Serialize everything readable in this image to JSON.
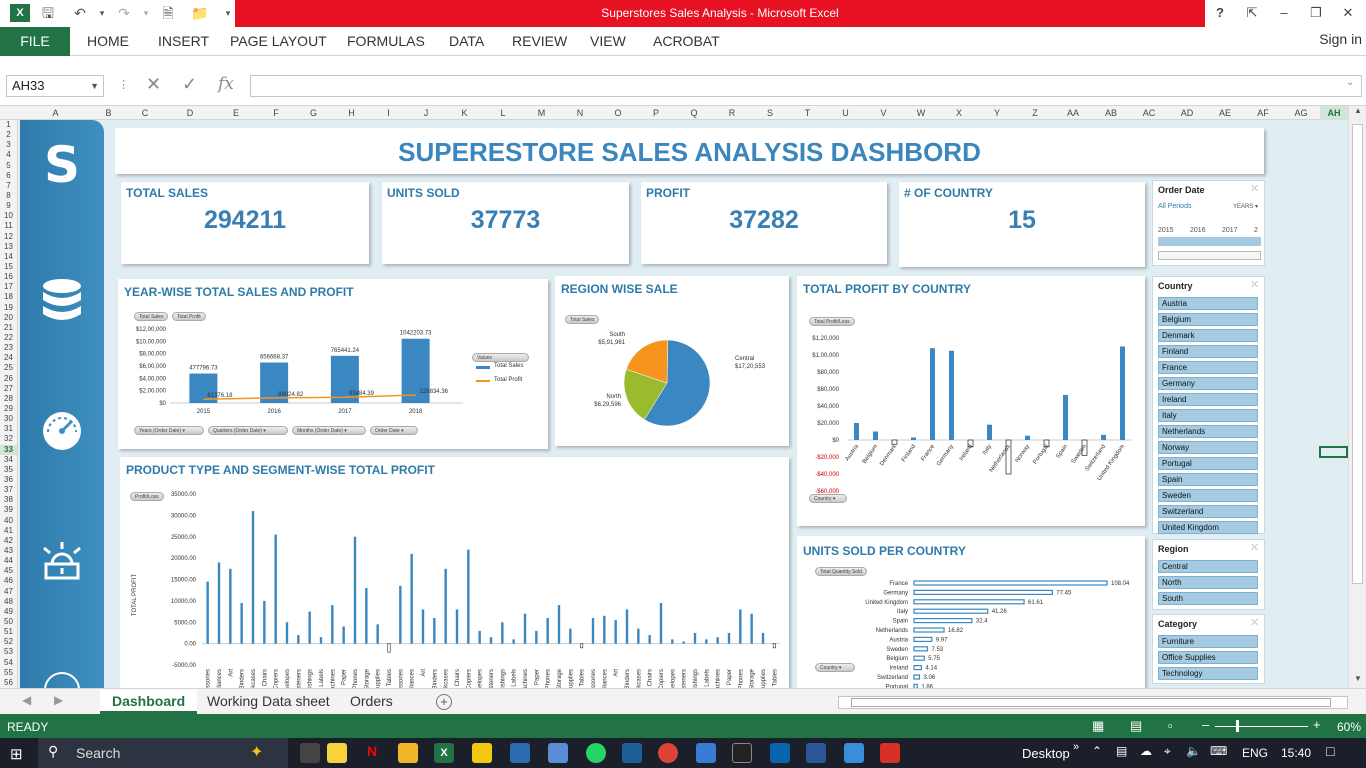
{
  "window": {
    "title": "Superstores Sales Analysis -  Microsoft Excel",
    "help": "?"
  },
  "ribbon": {
    "file": "FILE",
    "tabs": [
      "HOME",
      "INSERT",
      "PAGE LAYOUT",
      "FORMULAS",
      "DATA",
      "REVIEW",
      "VIEW",
      "ACROBAT"
    ],
    "sign_in": "Sign in"
  },
  "formula_bar": {
    "name_box": "AH33",
    "fx": "fx",
    "formula": ""
  },
  "columns": [
    "A",
    "B",
    "C",
    "D",
    "E",
    "F",
    "G",
    "H",
    "I",
    "J",
    "K",
    "L",
    "M",
    "N",
    "O",
    "P",
    "Q",
    "R",
    "S",
    "T",
    "U",
    "V",
    "W",
    "X",
    "Y",
    "Z",
    "AA",
    "AB",
    "AC",
    "AD",
    "AE",
    "AF",
    "AG",
    "AH"
  ],
  "rows": [
    "1",
    "2",
    "3",
    "4",
    "5",
    "6",
    "7",
    "8",
    "9",
    "10",
    "11",
    "12",
    "13",
    "14",
    "15",
    "16",
    "17",
    "18",
    "19",
    "20",
    "21",
    "22",
    "23",
    "24",
    "25",
    "26",
    "27",
    "28",
    "29",
    "30",
    "31",
    "32",
    "33",
    "34",
    "35",
    "36",
    "37",
    "38",
    "39",
    "40",
    "41",
    "42",
    "43",
    "44",
    "45",
    "46",
    "47",
    "48",
    "49",
    "50",
    "51",
    "52",
    "53",
    "54",
    "55",
    "56"
  ],
  "dashboard": {
    "title": "SUPERESTORE SALES ANALYSIS DASHBORD",
    "sidebar_logo": "S",
    "kpis": [
      {
        "label": "TOTAL SALES",
        "value": "294211"
      },
      {
        "label": "UNITS SOLD",
        "value": "37773"
      },
      {
        "label": "PROFIT",
        "value": "37282"
      },
      {
        "label": "# OF COUNTRY",
        "value": "15"
      }
    ],
    "year_chart": {
      "title": "YEAR-WISE TOTAL SALES AND PROFIT",
      "pills": [
        "Total Sales",
        "Total Profit"
      ],
      "legend_title": "Values",
      "filters": [
        "Years (Order Date)",
        "Quarters (Order Date)",
        "Months (Order Date)",
        "Order Date"
      ]
    },
    "region_chart": {
      "title": "REGION WISE SALE",
      "pill": "Total Sales"
    },
    "profit_country_chart": {
      "title": "TOTAL PROFIT BY COUNTRY",
      "pill": "Total Profit/Loss",
      "filter": "Country"
    },
    "units_country_chart": {
      "title": "UNITS SOLD PER COUNTRY",
      "pill": "Total Quantity Sold",
      "filter": "Country"
    },
    "product_chart": {
      "title": "PRODUCT TYPE AND SEGMENT-WISE TOTAL PROFIT",
      "pill": "Profit/Loss",
      "ylabel": "TOTAL PROFIT"
    },
    "slicer_date": {
      "title": "Order Date",
      "all": "All Periods",
      "level": "YEARS",
      "years": [
        "2015",
        "2016",
        "2017",
        "2"
      ]
    },
    "slicer_country": {
      "title": "Country",
      "items": [
        "Austria",
        "Belgium",
        "Denmark",
        "Finland",
        "France",
        "Germany",
        "Ireland",
        "Italy",
        "Netherlands",
        "Norway",
        "Portugal",
        "Spain",
        "Sweden",
        "Switzerland",
        "United Kingdom"
      ]
    },
    "slicer_region": {
      "title": "Region",
      "items": [
        "Central",
        "North",
        "South"
      ]
    },
    "slicer_category": {
      "title": "Category",
      "items": [
        "Furniture",
        "Office Supplies",
        "Technology"
      ]
    }
  },
  "chart_data": [
    {
      "type": "bar",
      "title": "YEAR-WISE TOTAL SALES AND PROFIT",
      "categories": [
        "2015",
        "2016",
        "2017",
        "2018"
      ],
      "series": [
        {
          "name": "Total Sales",
          "values": [
            477796.73,
            656668.37,
            765441.24,
            1042203.73
          ]
        },
        {
          "name": "Total Profit",
          "values": [
            61376.18,
            84024.82,
            93484.39,
            128834.36
          ]
        }
      ],
      "value_labels": [
        "477796.73",
        "656668.37",
        "765441.24",
        "1042203.73"
      ],
      "profit_labels": [
        "61376.18",
        "84024.82",
        "93484.39",
        "128834.36"
      ],
      "yticks": [
        "$12,00,000",
        "$10,00,000",
        "$8,00,000",
        "$6,00,000",
        "$4,00,000",
        "$2,00,000",
        "$0"
      ],
      "ylim": [
        0,
        1200000
      ]
    },
    {
      "type": "pie",
      "title": "REGION WISE SALE",
      "labels": [
        "Central",
        "North",
        "South"
      ],
      "values": [
        1720553,
        629596,
        591961
      ],
      "value_labels": [
        "$17,20,553",
        "$6,29,596",
        "$5,91,961"
      ],
      "colors": [
        "#3a87c2",
        "#9bbb2f",
        "#f7941d"
      ]
    },
    {
      "type": "bar",
      "title": "TOTAL PROFIT BY COUNTRY",
      "categories": [
        "Austria",
        "Belgium",
        "Denmark",
        "Finland",
        "France",
        "Germany",
        "Ireland",
        "Italy",
        "Netherlands",
        "Norway",
        "Portugal",
        "Spain",
        "Sweden",
        "Switzerland",
        "United Kingdom"
      ],
      "values": [
        20000,
        10000,
        -5000,
        3000,
        108000,
        105000,
        -8000,
        18000,
        -40000,
        5000,
        -8000,
        53000,
        -18000,
        6000,
        110000
      ],
      "yticks": [
        "$1,20,000",
        "$1,00,000",
        "$80,000",
        "$60,000",
        "$40,000",
        "$20,000",
        "$0",
        "-$20,000",
        "-$40,000",
        "-$60,000"
      ],
      "ylim": [
        -60000,
        120000
      ]
    },
    {
      "type": "bar",
      "title": "UNITS SOLD PER COUNTRY",
      "categories": [
        "France",
        "Germany",
        "United Kingdom",
        "Italy",
        "Spain",
        "Netherlands",
        "Austria",
        "Sweden",
        "Belgium",
        "Ireland",
        "Switzerland",
        "Portugal"
      ],
      "values": [
        108.04,
        77.45,
        61.61,
        41.26,
        32.4,
        16.82,
        9.97,
        7.53,
        5.75,
        4.14,
        3.06,
        1.86
      ],
      "value_labels": [
        "108.04",
        "77.45",
        "61.61",
        "41.26",
        "32.4",
        "16.82",
        "9.97",
        "7.53",
        "5.75",
        "4.14",
        "3.06",
        "1.86"
      ]
    },
    {
      "type": "bar",
      "title": "PRODUCT TYPE AND SEGMENT-WISE TOTAL PROFIT",
      "categories": [
        "essories",
        "ppliances",
        "Art",
        "Binders",
        "okcases",
        "Chairs",
        "Copiers",
        "welopes",
        "asteners",
        "rnishings",
        "Labels",
        "achines",
        "Paper",
        "Phones",
        "Storage",
        "Supplies",
        "Tables"
      ],
      "series": [
        {
          "values": [
            14500,
            19000,
            17500,
            9500,
            31000,
            10000,
            25500,
            5000,
            2000,
            7500,
            1500,
            9000,
            4000,
            25000,
            13000,
            4500,
            -2000
          ]
        },
        {
          "values": [
            13500,
            21000,
            8000,
            6000,
            17500,
            8000,
            22000,
            3000,
            1500,
            5000,
            1000,
            7000,
            3000,
            6000,
            9000,
            3500,
            -1000
          ]
        },
        {
          "values": [
            6000,
            6500,
            5500,
            8000,
            3500,
            2000,
            9500,
            1000,
            500,
            2500,
            1000,
            1500,
            2500,
            8000,
            7000,
            2500,
            -1000
          ]
        }
      ],
      "yticks": [
        "35000.00",
        "30000.00",
        "25000.00",
        "20000.00",
        "15000.00",
        "10000.00",
        "5000.00",
        "0.00",
        "-5000.00"
      ],
      "ylim": [
        -5000,
        35000
      ]
    }
  ],
  "sheet_tabs": [
    "Dashboard",
    "Working Data sheet",
    "Orders"
  ],
  "status": {
    "ready": "READY",
    "zoom": "60%"
  },
  "taskbar": {
    "search": "Search",
    "desktop": "Desktop",
    "lang": "ENG",
    "time": "15:40"
  }
}
